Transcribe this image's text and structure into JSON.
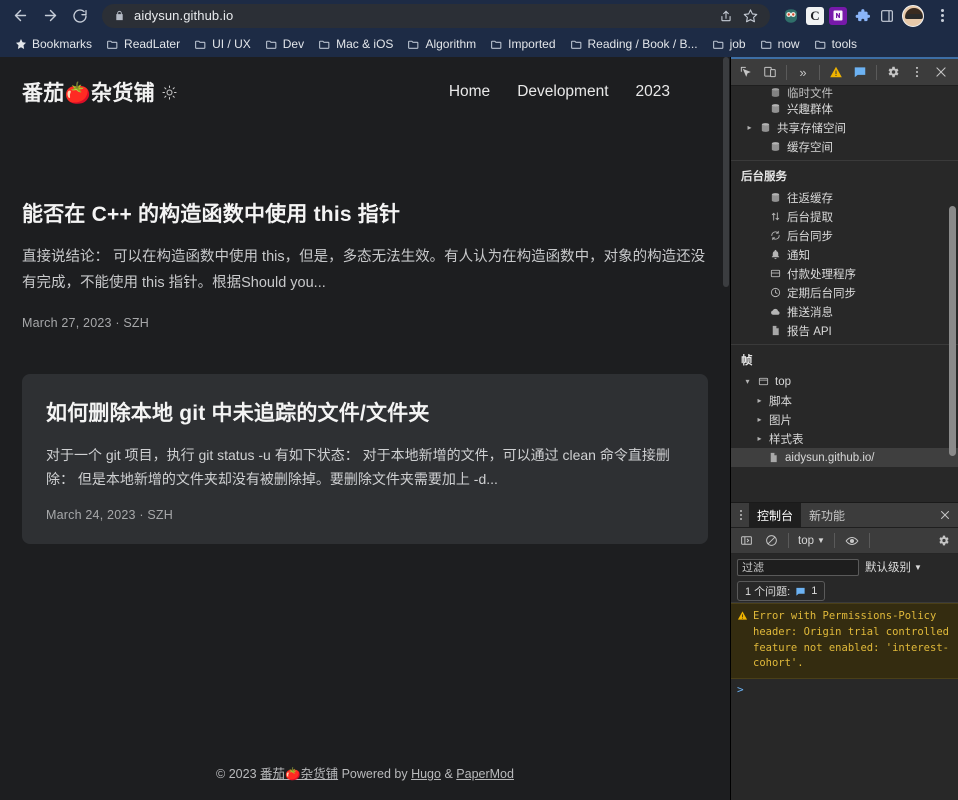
{
  "browser": {
    "nav": {
      "back_label": "Back",
      "forward_label": "Forward",
      "reload_label": "Reload"
    },
    "omnibox": {
      "url": "aidysun.github.io",
      "lock_icon": "lock-icon",
      "share_icon": "share-icon",
      "bookmark_icon": "star-icon"
    },
    "extensions": [
      {
        "name": "owl-extension-icon",
        "glyph": "●●"
      },
      {
        "name": "cite-extension-icon",
        "glyph": "C"
      },
      {
        "name": "onenote-extension-icon",
        "glyph": "N"
      },
      {
        "name": "extensions-puzzle-icon",
        "glyph": "❖"
      },
      {
        "name": "side-panel-icon",
        "glyph": "▯"
      }
    ],
    "profile_label": "Profile",
    "menu_label": "Customize and control",
    "bookmarks": [
      {
        "label": "Bookmarks",
        "icon": "star-icon"
      },
      {
        "label": "ReadLater",
        "icon": "folder-icon"
      },
      {
        "label": "UI / UX",
        "icon": "folder-icon"
      },
      {
        "label": "Dev",
        "icon": "folder-icon"
      },
      {
        "label": "Mac & iOS",
        "icon": "folder-icon"
      },
      {
        "label": "Algorithm",
        "icon": "folder-icon"
      },
      {
        "label": "Imported",
        "icon": "folder-icon"
      },
      {
        "label": "Reading / Book / B...",
        "icon": "folder-icon"
      },
      {
        "label": "job",
        "icon": "folder-icon"
      },
      {
        "label": "now",
        "icon": "folder-icon"
      },
      {
        "label": "tools",
        "icon": "folder-icon"
      }
    ]
  },
  "site": {
    "title": "番茄🍅杂货铺",
    "theme_toggle_icon": "sun-icon",
    "nav": [
      {
        "label": "Home"
      },
      {
        "label": "Development"
      },
      {
        "label": "2023"
      }
    ],
    "posts": [
      {
        "title": "能否在 C++ 的构造函数中使用 this 指针",
        "summary": "直接说结论： 可以在构造函数中使用 this，但是，多态无法生效。有人认为在构造函数中，对象的构造还没有完成，不能使用 this 指针。根据Should you...",
        "meta": "March 27, 2023 · SZH"
      },
      {
        "title": "如何删除本地 git 中未追踪的文件/文件夹",
        "summary": "对于一个 git 项目，执行 git status -u 有如下状态： 对于本地新增的文件，可以通过 clean 命令直接删除： 但是本地新增的文件夹却没有被删除掉。要删除文件夹需要加上 -d...",
        "meta": "March 24, 2023 · SZH"
      }
    ],
    "footer": {
      "copyright": "© 2023",
      "brand": "番茄🍅杂货铺",
      "powered_by": "Powered by",
      "hugo": "Hugo",
      "amp": "&",
      "papermod": "PaperMod"
    }
  },
  "devtools": {
    "toolbar": {
      "inspect_icon": "inspect-element-icon",
      "device_icon": "device-toolbar-icon",
      "more_tabs_label": "»",
      "warning_icon": "warning-triangle-icon",
      "message_icon": "message-icon",
      "settings_icon": "gear-icon",
      "kebab_icon": "kebab-menu-icon",
      "close_icon": "close-icon"
    },
    "application_tree": {
      "clipped_row": {
        "label": "临时文件",
        "icon": "database-icon"
      },
      "storage_rows": [
        {
          "label": "兴趣群体",
          "icon": "database-icon",
          "arrow": false,
          "indent": 1
        },
        {
          "label": "共享存储空间",
          "icon": "database-icon",
          "arrow": true,
          "indent": 1
        },
        {
          "label": "缓存空间",
          "icon": "database-icon",
          "arrow": false,
          "indent": 1
        }
      ],
      "background_services": {
        "title": "后台服务",
        "items": [
          {
            "label": "往返缓存",
            "icon": "database-icon"
          },
          {
            "label": "后台提取",
            "icon": "updown-arrows-icon"
          },
          {
            "label": "后台同步",
            "icon": "sync-icon"
          },
          {
            "label": "通知",
            "icon": "bell-icon"
          },
          {
            "label": "付款处理程序",
            "icon": "payment-icon"
          },
          {
            "label": "定期后台同步",
            "icon": "clock-icon"
          },
          {
            "label": "推送消息",
            "icon": "cloud-icon"
          },
          {
            "label": "报告 API",
            "icon": "document-icon"
          }
        ]
      },
      "frames": {
        "title": "帧",
        "items": [
          {
            "label": "top",
            "icon": "frame-icon",
            "arrow": "down",
            "indent": 1
          },
          {
            "label": "脚本",
            "icon": "",
            "arrow": "right",
            "indent": 2
          },
          {
            "label": "图片",
            "icon": "",
            "arrow": "right",
            "indent": 2
          },
          {
            "label": "样式表",
            "icon": "",
            "arrow": "right",
            "indent": 2
          },
          {
            "label": "aidysun.github.io/",
            "icon": "document-icon",
            "arrow": "",
            "indent": 3,
            "selected": true
          }
        ]
      }
    },
    "drawer": {
      "kebab_icon": "kebab-menu-icon",
      "tabs": [
        {
          "label": "控制台",
          "active": true
        },
        {
          "label": "新功能",
          "active": false
        }
      ],
      "close_icon": "close-icon",
      "console_toolbar": {
        "sidebar_icon": "console-sidebar-icon",
        "clear_icon": "clear-console-icon",
        "context": "top",
        "eye_icon": "live-expression-icon",
        "settings_icon": "gear-icon"
      },
      "filter": {
        "placeholder": "过滤",
        "value": "",
        "level_label": "默认级别"
      },
      "issues": {
        "label": "1 个问题:",
        "count": "1",
        "icon": "message-icon"
      },
      "messages": [
        {
          "icon": "warning-triangle-icon",
          "text": "Error with Permissions-Policy header: Origin trial controlled feature not enabled: 'interest-cohort'."
        }
      ],
      "prompt_symbol": ">"
    }
  }
}
